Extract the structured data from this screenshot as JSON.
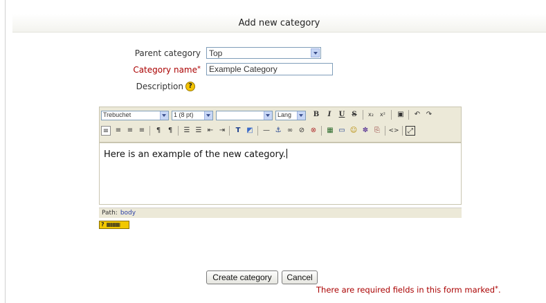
{
  "header": {
    "title": "Add new category"
  },
  "form": {
    "parent": {
      "label": "Parent category",
      "value": "Top"
    },
    "name": {
      "label": "Category name",
      "required_mark": "*",
      "value": "Example Category"
    },
    "description": {
      "label": "Description",
      "help_icon": "?"
    }
  },
  "editor": {
    "font_select": "Trebuchet",
    "size_select": "1 (8 pt)",
    "format_select": "",
    "lang_select": "Lang",
    "toolbar_row1": [
      "B",
      "I",
      "U",
      "S",
      "x₂",
      "x²",
      "▣",
      "↶",
      "↷"
    ],
    "toolbar_row2": [
      "≡",
      "≡",
      "≡",
      "≡",
      "¶",
      "¶",
      "☰",
      "☰",
      "⇤",
      "⇥",
      "T",
      "◩",
      "—",
      "⚓",
      "∞",
      "⊘",
      "⊗",
      "▦",
      "▭",
      "☺",
      "✽",
      "⎘",
      "<>",
      "⤢"
    ],
    "content": "Here is an example of the new category.",
    "path_label": "Path:",
    "path_value": "body",
    "keyboard_help": "?"
  },
  "buttons": {
    "create": "Create category",
    "cancel": "Cancel"
  },
  "footer": {
    "required_note": "There are required fields in this form marked",
    "required_mark": "*",
    "required_end": "."
  },
  "colors": {
    "required": "#aa0000",
    "toolbar_bg": "#ece9d8",
    "path_link": "#2a3fa5"
  }
}
